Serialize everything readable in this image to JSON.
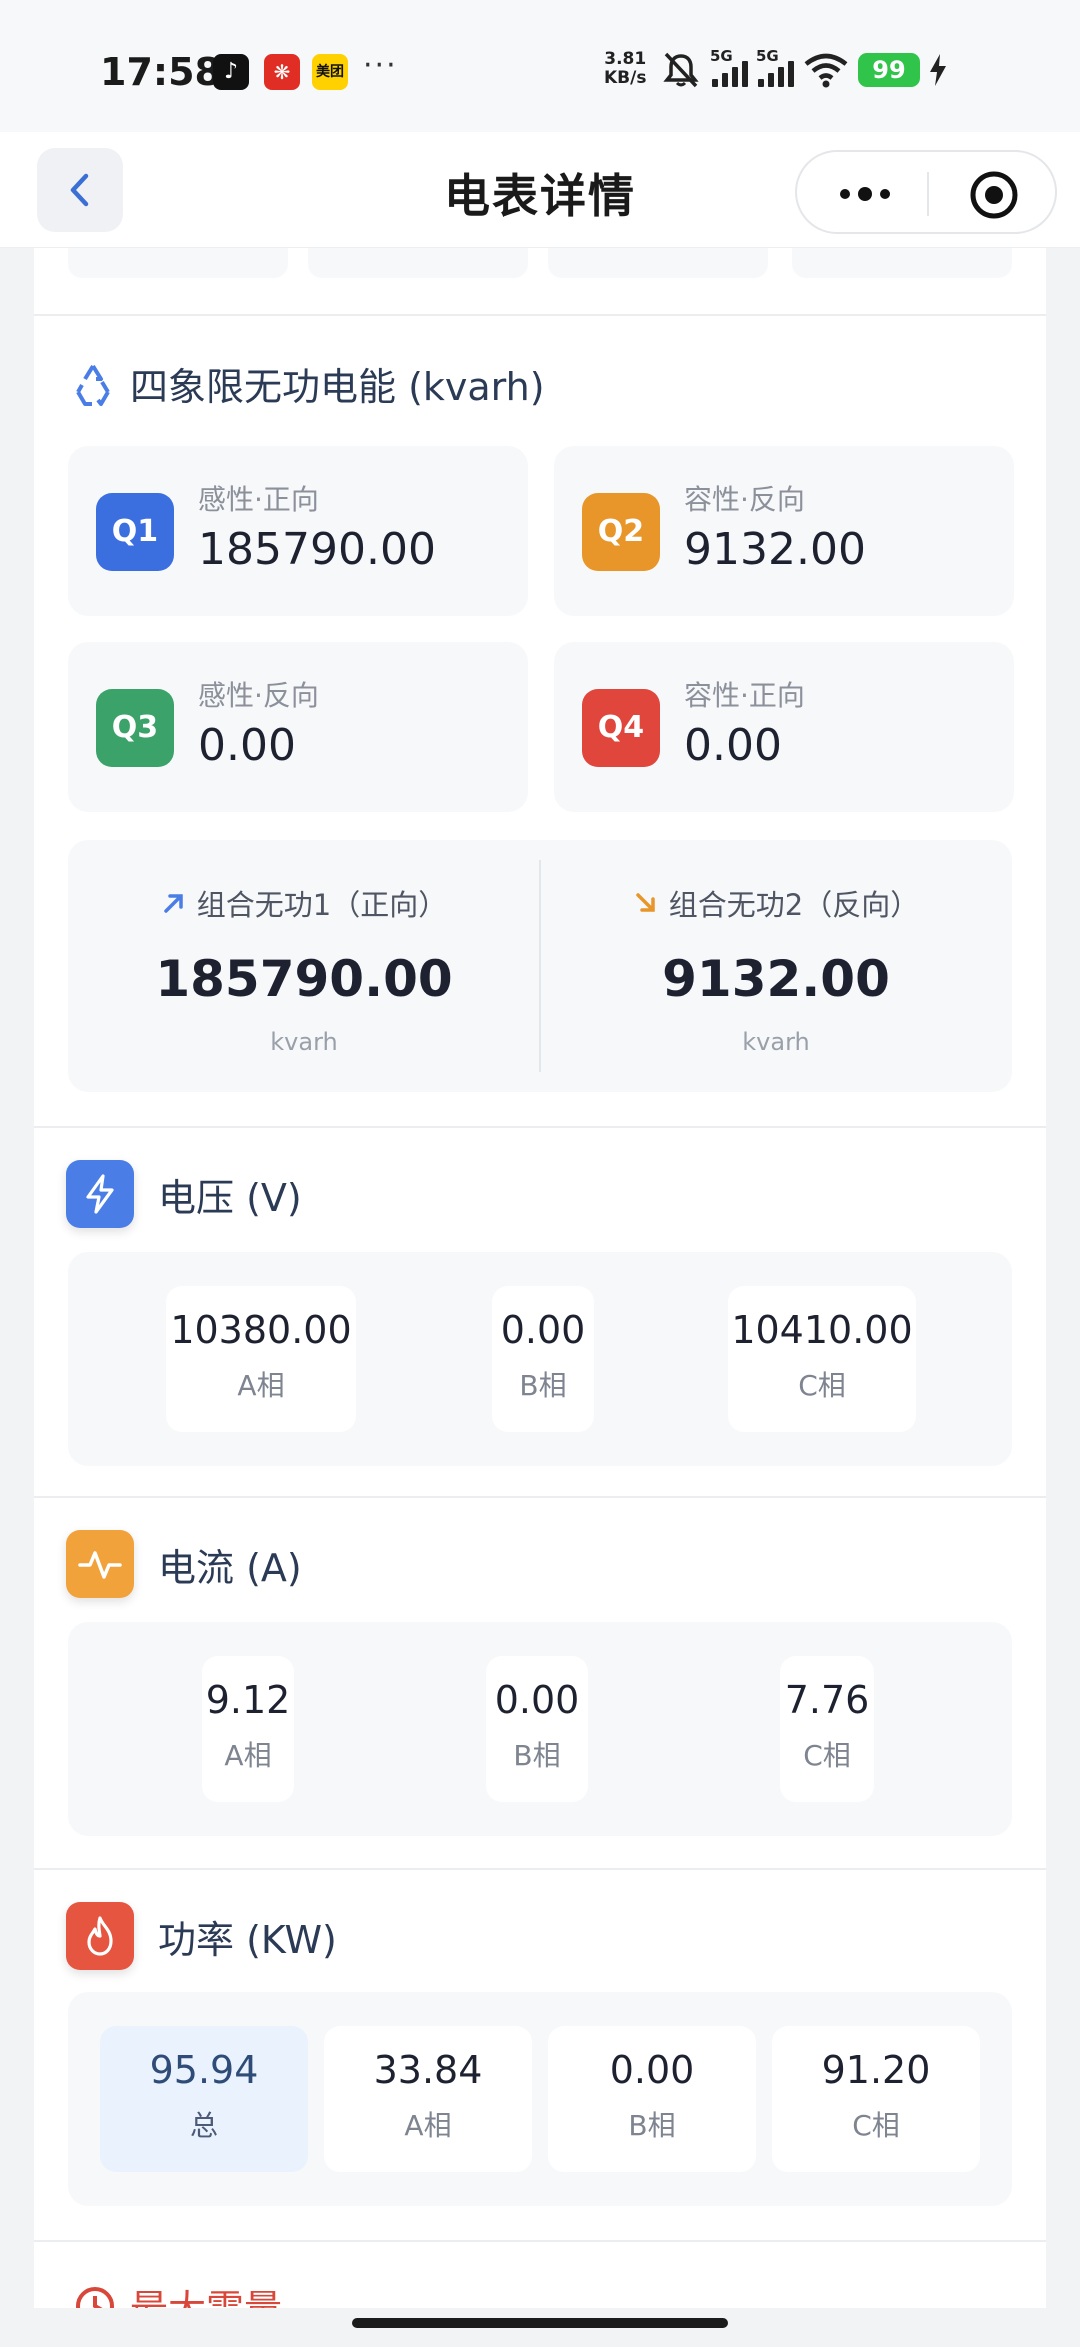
{
  "status_bar": {
    "time": "17:58",
    "apps": [
      "tiktok-icon",
      "pinduoduo-icon",
      "meituan-icon"
    ],
    "meituan_label": "美团",
    "more": "···",
    "net_speed_value": "3.81",
    "net_speed_unit": "KB/s",
    "sim1": "5G",
    "sim2": "5G",
    "battery": "99"
  },
  "nav": {
    "title": "电表详情"
  },
  "reactive": {
    "title": "四象限无功电能 (kvarh)",
    "quadrants": [
      {
        "badge": "Q1",
        "label": "感性·正向",
        "value": "185790.00",
        "color": "#3b6fe0"
      },
      {
        "badge": "Q2",
        "label": "容性·反向",
        "value": "9132.00",
        "color": "#e8962a"
      },
      {
        "badge": "Q3",
        "label": "感性·反向",
        "value": "0.00",
        "color": "#3ba36a"
      },
      {
        "badge": "Q4",
        "label": "容性·正向",
        "value": "0.00",
        "color": "#e0463b"
      }
    ],
    "combined": [
      {
        "label": "组合无功1（正向）",
        "value": "185790.00",
        "unit": "kvarh"
      },
      {
        "label": "组合无功2（反向）",
        "value": "9132.00",
        "unit": "kvarh"
      }
    ]
  },
  "voltage": {
    "title": "电压 (V)",
    "cells": [
      {
        "value": "10380.00",
        "label": "A相"
      },
      {
        "value": "0.00",
        "label": "B相"
      },
      {
        "value": "10410.00",
        "label": "C相"
      }
    ]
  },
  "current": {
    "title": "电流 (A)",
    "cells": [
      {
        "value": "9.12",
        "label": "A相"
      },
      {
        "value": "0.00",
        "label": "B相"
      },
      {
        "value": "7.76",
        "label": "C相"
      }
    ]
  },
  "power": {
    "title": "功率 (KW)",
    "cells": [
      {
        "value": "95.94",
        "label": "总"
      },
      {
        "value": "33.84",
        "label": "A相"
      },
      {
        "value": "0.00",
        "label": "B相"
      },
      {
        "value": "91.20",
        "label": "C相"
      }
    ]
  },
  "next_section": {
    "title": "最大需量"
  },
  "colors": {
    "accent_blue": "#4a7ee6",
    "accent_orange": "#f2a23a",
    "accent_red": "#e5553f"
  }
}
